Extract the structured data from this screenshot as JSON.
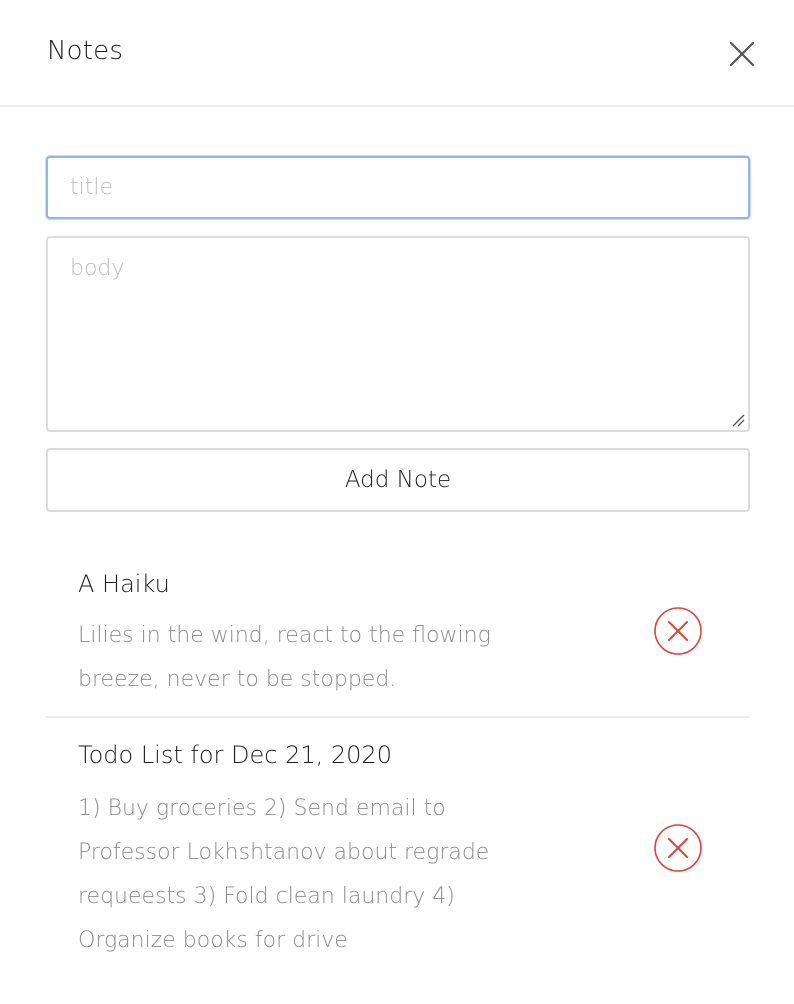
{
  "header": {
    "title": "Notes",
    "close_icon": "close-icon"
  },
  "form": {
    "title_placeholder": "title",
    "title_value": "",
    "body_placeholder": "body",
    "body_value": "",
    "add_button_label": "Add Note"
  },
  "notes": [
    {
      "title": "A Haiku",
      "body": "Lilies in the wind, react to the flowing breeze, never to be stopped.",
      "delete_icon": "delete-circle-x-icon"
    },
    {
      "title": "Todo List for Dec 21, 2020",
      "body": "1) Buy groceries 2) Send email to Professor Lokhshtanov about regrade requeests 3) Fold clean laundry 4) Organize books for drive",
      "delete_icon": "delete-circle-x-icon"
    }
  ],
  "colors": {
    "focus_border": "#8fb5ee",
    "delete_red": "#e0453a",
    "muted_text": "#8c8c8c",
    "border": "#dcdcdc"
  }
}
